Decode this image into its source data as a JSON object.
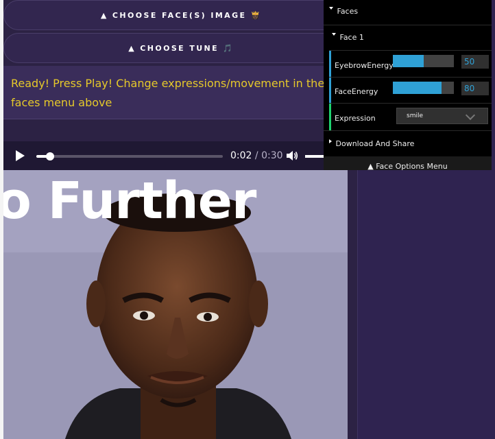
{
  "header": {
    "choose_face_label": "▲ CHOOSE FACE(S) IMAGE",
    "choose_face_emoji": "👸🏿",
    "choose_tune_label": "▲ CHOOSE TUNE",
    "choose_tune_emoji": "🎵"
  },
  "status": {
    "message": "Ready! Press Play! Change expressions/movement in the faces menu above"
  },
  "player": {
    "current_time": "0:02",
    "separator": "/",
    "duration": "0:30",
    "progress_fraction": 0.074
  },
  "photo": {
    "banner_text": "o Further"
  },
  "menu": {
    "faces_folder": "Faces",
    "face1_folder": "Face 1",
    "eyebrow_label": "EyebrowEnergy",
    "eyebrow_value": "50",
    "eyebrow_fraction": 0.5,
    "face_energy_label": "FaceEnergy",
    "face_energy_value": "80",
    "face_energy_fraction": 0.8,
    "expression_label": "Expression",
    "expression_value": "smile",
    "download_label": "Download And Share",
    "close_label": "▲ Face Options Menu"
  },
  "colors": {
    "accent": "#2fa1d6",
    "status_text": "#e6c92a",
    "folder_green": "#1ed36f"
  }
}
